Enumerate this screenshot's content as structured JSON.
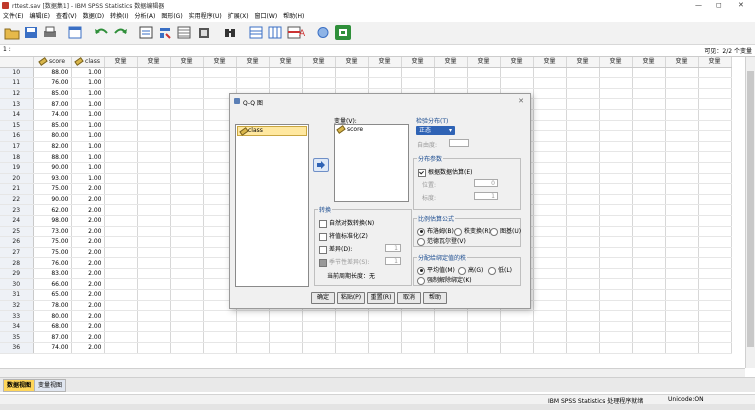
{
  "window": {
    "title": "rttest.sav [数据集1] - IBM SPSS Statistics 数据编辑器",
    "min": "—",
    "max": "◻",
    "close": "✕"
  },
  "menu": [
    "文件(E)",
    "编辑(E)",
    "查看(V)",
    "数据(D)",
    "转换(I)",
    "分析(A)",
    "图形(G)",
    "实用程序(U)",
    "扩展(X)",
    "窗口(W)",
    "帮助(H)"
  ],
  "editrow": {
    "cell_ref": "1 :",
    "visible": "可见：2/2 个变量"
  },
  "grid": {
    "headers": [
      "score",
      "class",
      "变量",
      "变量",
      "变量",
      "变量",
      "变量",
      "变量",
      "变量",
      "变量",
      "变量",
      "变量",
      "变量",
      "变量",
      "变量",
      "变量",
      "变量",
      "变量",
      "变量",
      "变量",
      "变量"
    ],
    "rows": [
      {
        "n": "10",
        "score": "88.00",
        "class": "1.00"
      },
      {
        "n": "11",
        "score": "76.00",
        "class": "1.00"
      },
      {
        "n": "12",
        "score": "85.00",
        "class": "1.00"
      },
      {
        "n": "13",
        "score": "87.00",
        "class": "1.00"
      },
      {
        "n": "14",
        "score": "74.00",
        "class": "1.00"
      },
      {
        "n": "15",
        "score": "85.00",
        "class": "1.00"
      },
      {
        "n": "16",
        "score": "80.00",
        "class": "1.00"
      },
      {
        "n": "17",
        "score": "82.00",
        "class": "1.00"
      },
      {
        "n": "18",
        "score": "88.00",
        "class": "1.00"
      },
      {
        "n": "19",
        "score": "90.00",
        "class": "1.00"
      },
      {
        "n": "20",
        "score": "93.00",
        "class": "1.00"
      },
      {
        "n": "21",
        "score": "75.00",
        "class": "2.00"
      },
      {
        "n": "22",
        "score": "90.00",
        "class": "2.00"
      },
      {
        "n": "23",
        "score": "62.00",
        "class": "2.00"
      },
      {
        "n": "24",
        "score": "98.00",
        "class": "2.00"
      },
      {
        "n": "25",
        "score": "73.00",
        "class": "2.00"
      },
      {
        "n": "26",
        "score": "75.00",
        "class": "2.00"
      },
      {
        "n": "27",
        "score": "75.00",
        "class": "2.00"
      },
      {
        "n": "28",
        "score": "76.00",
        "class": "2.00"
      },
      {
        "n": "29",
        "score": "83.00",
        "class": "2.00"
      },
      {
        "n": "30",
        "score": "66.00",
        "class": "2.00"
      },
      {
        "n": "31",
        "score": "65.00",
        "class": "2.00"
      },
      {
        "n": "32",
        "score": "78.00",
        "class": "2.00"
      },
      {
        "n": "33",
        "score": "80.00",
        "class": "2.00"
      },
      {
        "n": "34",
        "score": "68.00",
        "class": "2.00"
      },
      {
        "n": "35",
        "score": "87.00",
        "class": "2.00"
      },
      {
        "n": "36",
        "score": "74.00",
        "class": "2.00"
      }
    ]
  },
  "tabs": {
    "data_view": "数据视图",
    "variable_view": "变量视图"
  },
  "status": {
    "processor": "IBM SPSS Statistics 处理程序就绪",
    "unicode": "Unicode:ON"
  },
  "dialog": {
    "title": "Q-Q 图",
    "source_var": "class",
    "variables_label": "变量(V):",
    "selected_var": "score",
    "transform": {
      "title": "转换",
      "natural_log": "自然对数转换(N)",
      "standardize": "将值标准化(Z)",
      "difference": "差异(D):",
      "difference_val": "1",
      "seasonal_diff": "季节性差异(S):",
      "seasonal_val": "1",
      "current_period": "当前周期长度：无"
    },
    "dist": {
      "title": "检验分布(T)",
      "value": "正态",
      "df_label": "自由度:"
    },
    "params": {
      "title": "分布参数",
      "estimate": "根据数据估算(E)",
      "location": "位置:",
      "location_val": "0",
      "scale": "标度:",
      "scale_val": "1"
    },
    "proportion": {
      "title": "比例估算公式",
      "blom": "布洛姆(B)",
      "rankit": "秩变换(R)",
      "tukey": "图基(U)",
      "vdw": "范德瓦尔登(V)"
    },
    "ties": {
      "title": "分配给绑定值的秩",
      "mean": "平均值(M)",
      "high": "高(G)",
      "low": "低(L)",
      "break": "强制解除绑定(K)"
    },
    "buttons": {
      "ok": "确定",
      "paste": "粘贴(P)",
      "reset": "重置(R)",
      "cancel": "取消",
      "help": "帮助"
    }
  }
}
